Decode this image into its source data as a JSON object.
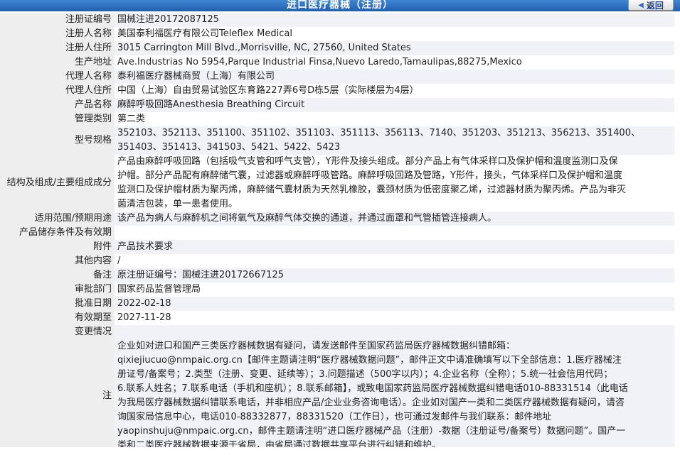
{
  "header": {
    "title": "进口医疗器械（注册）",
    "back_label": "返回"
  },
  "rows": [
    {
      "label": "注册证编号",
      "value": "国械注进20172087125"
    },
    {
      "label": "注册人名称",
      "value": "美国泰利福医疗有限公司Teleflex Medical"
    },
    {
      "label": "注册人住所",
      "value": "3015 Carrington Mill Blvd.,Morrisville, NC, 27560, United States"
    },
    {
      "label": "生产地址",
      "value": "Ave.Industrias No 5954,Parque Industrial Finsa,Nuevo Laredo,Tamaulipas,88275,Mexico"
    },
    {
      "label": "代理人名称",
      "value": "泰利福医疗器械商贸（上海）有限公司"
    },
    {
      "label": "代理人住所",
      "value": "中国（上海）自由贸易试验区东育路227弄6号D栋5层（实际楼层为4层）"
    },
    {
      "label": "产品名称",
      "value": "麻醉呼吸回路Anesthesia Breathing Circuit"
    },
    {
      "label": "管理类别",
      "value": "第二类"
    },
    {
      "label": "型号规格",
      "lines": [
        "352103、352113、351100、351102、351103、351113、356113、7140、351203、351213、356213、351400、",
        "351403、351413、341503、5421、5422、5423"
      ]
    },
    {
      "label": "结构及组成/主要组成成分",
      "lines": [
        "产品由麻醉呼吸回路（包括吸气支管和呼气支管），Y形件及接头组成。部分产品上有气体采样口及保护帽和温度监测口及保",
        "护帽。部分产品配有麻醉储气囊，过滤器或麻醉呼吸管路。麻醉呼吸回路及管路，Y形件，接头，气体采样口及保护帽和温度",
        "监测口及保护帽材质为聚丙烯，麻醉储气囊材质为天然乳橡胶，囊颈材质为低密度聚乙烯，过滤器材质为聚丙烯。产品为非灭",
        "菌清洁包装，单一患者使用。"
      ]
    },
    {
      "label": "适用范围/预期用途",
      "value": "该产品为病人与麻醉机之间将氧气及麻醉气体交换的通道，并通过面罩和气管插管连接病人。"
    },
    {
      "label": "产品储存条件及有效期",
      "value": ""
    },
    {
      "label": "附件",
      "value": "产品技术要求"
    },
    {
      "label": "其他内容",
      "value": "/"
    },
    {
      "label": "备注",
      "value": "原注册证编号：国械注进20172667125"
    },
    {
      "label": "审批部门",
      "value": "国家药品监督管理局"
    },
    {
      "label": "批准日期",
      "value": "2022-02-18"
    },
    {
      "label": "有效期至",
      "value": "2027-11-28"
    },
    {
      "label": "变更情况",
      "value": ""
    }
  ],
  "note": {
    "label": "注",
    "lines": [
      "企业如对进口和国产三类医疗器械数据有疑问，请发送邮件至国家药监局医疗器械数据纠错邮箱：",
      "qixiejiucuo@nmpaic.org.cn【邮件主题请注明“医疗器械数据问题”，邮件正文中请准确填写以下全部信息：1.医疗器械注",
      "册证号/备案号；2.类型（注册、变更、延续等）；3.问题描述（500字以内）；4.企业名称（全称）；5.统一社会信用代码；",
      "6.联系人姓名；7.联系电话（手机和座机）；8.联系邮箱】，或致电国家药监局医疗器械数据纠错电话010-88331514（此电话",
      "为我局医疗器械数据纠错联系电话，并非相应产品/企业业务咨询电话）。企业如对国产一类和二类医疗器械数据有疑问，请咨",
      "询国家局信息中心，电话010-88332877，88331520（工作日），也可通过发邮件与我们联系：邮件地址",
      "yaopinshuju@nmpaic.org.cn，邮件主题请注明“进口医疗器械产品（注册）-数据（注册证号/备案号）数据问题”。国产一",
      "类和二类医疗器械数据来源于省局，由省局通过数据共享平台进行纠错和维护。"
    ]
  }
}
